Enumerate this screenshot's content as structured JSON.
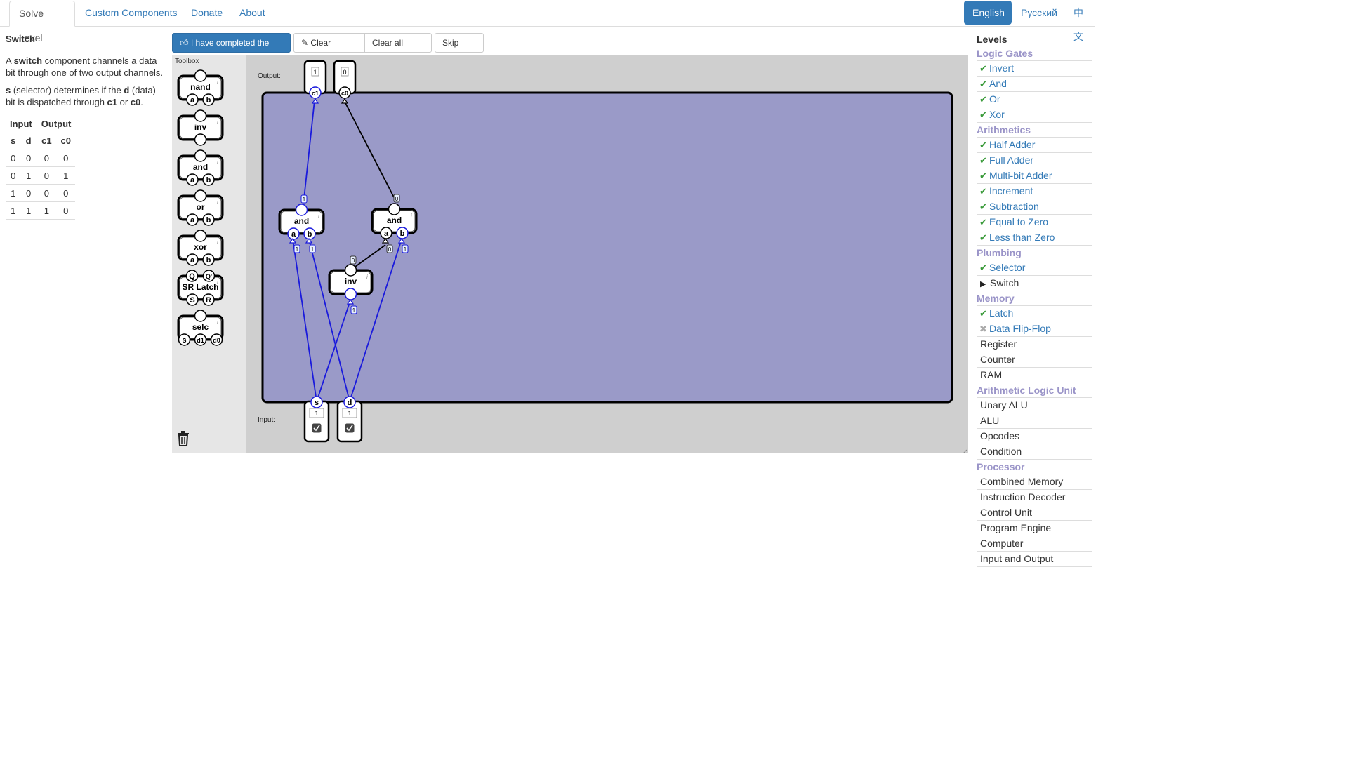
{
  "nav": {
    "tabs": [
      "Solve Level",
      "Custom Components",
      "Donate",
      "About"
    ],
    "languages": [
      "English",
      "Русский",
      "中文"
    ]
  },
  "level": {
    "title": "Switch",
    "desc1_pre": "A ",
    "desc1_bold": "switch",
    "desc1_post": " component channels a data bit through one of two output channels.",
    "desc2_b1": "s",
    "desc2_t1": " (selector) determines if the ",
    "desc2_b2": "d",
    "desc2_t2": " (data) bit is dispatched through ",
    "desc2_b3": "c1",
    "desc2_t3": " or ",
    "desc2_b4": "c0",
    "desc2_t4": ".",
    "truth_table": {
      "group_headers": [
        "Input",
        "Output"
      ],
      "columns": [
        "s",
        "d",
        "c1",
        "c0"
      ],
      "rows": [
        [
          "0",
          "0",
          "0",
          "0"
        ],
        [
          "0",
          "1",
          "0",
          "1"
        ],
        [
          "1",
          "0",
          "0",
          "0"
        ],
        [
          "1",
          "1",
          "1",
          "0"
        ]
      ]
    }
  },
  "toolbar": {
    "completed": "I have completed the level",
    "clear_canvas": "Clear canvas",
    "clear_all": "Clear all levels",
    "skip": "Skip level"
  },
  "toolbox": {
    "label": "Toolbox",
    "items": [
      {
        "name": "nand",
        "inputs": [
          "a",
          "b"
        ]
      },
      {
        "name": "inv",
        "inputs": []
      },
      {
        "name": "and",
        "inputs": [
          "a",
          "b"
        ]
      },
      {
        "name": "or",
        "inputs": [
          "a",
          "b"
        ]
      },
      {
        "name": "xor",
        "inputs": [
          "a",
          "b"
        ]
      },
      {
        "name": "SR Latch",
        "outputs": [
          "Q",
          "Q'"
        ],
        "inputs": [
          "S",
          "R"
        ]
      },
      {
        "name": "selc",
        "inputs": [
          "s",
          "d1",
          "d0"
        ]
      }
    ]
  },
  "canvas": {
    "output_label": "Output:",
    "input_label": "Input:",
    "outputs": [
      {
        "pin": "c1",
        "value": "1"
      },
      {
        "pin": "c0",
        "value": "0"
      }
    ],
    "inputs": [
      {
        "pin": "s",
        "value": "1",
        "checked": true
      },
      {
        "pin": "d",
        "value": "1",
        "checked": true
      }
    ],
    "gates": [
      {
        "id": "and1",
        "name": "and",
        "inputs": [
          "a",
          "b"
        ],
        "out_value": "1",
        "in_values": [
          "1",
          "1"
        ]
      },
      {
        "id": "and2",
        "name": "and",
        "inputs": [
          "a",
          "b"
        ],
        "out_value": "0",
        "in_values": [
          "0",
          "1"
        ]
      },
      {
        "id": "inv1",
        "name": "inv",
        "out_value": "0",
        "in_values": [
          "1"
        ]
      }
    ],
    "active_color": "#1a1adc",
    "board_color": "#9a9ac8"
  },
  "levels": {
    "title": "Levels",
    "groups": [
      {
        "name": "Logic Gates",
        "items": [
          {
            "label": "Invert",
            "status": "done"
          },
          {
            "label": "And",
            "status": "done"
          },
          {
            "label": "Or",
            "status": "done"
          },
          {
            "label": "Xor",
            "status": "done"
          }
        ]
      },
      {
        "name": "Arithmetics",
        "items": [
          {
            "label": "Half Adder",
            "status": "done"
          },
          {
            "label": "Full Adder",
            "status": "done"
          },
          {
            "label": "Multi-bit Adder",
            "status": "done"
          },
          {
            "label": "Increment",
            "status": "done"
          },
          {
            "label": "Subtraction",
            "status": "done"
          },
          {
            "label": "Equal to Zero",
            "status": "done"
          },
          {
            "label": "Less than Zero",
            "status": "done"
          }
        ]
      },
      {
        "name": "Plumbing",
        "items": [
          {
            "label": "Selector",
            "status": "done"
          },
          {
            "label": "Switch",
            "status": "current"
          }
        ]
      },
      {
        "name": "Memory",
        "items": [
          {
            "label": "Latch",
            "status": "done"
          },
          {
            "label": "Data Flip-Flop",
            "status": "failed"
          },
          {
            "label": "Register",
            "status": "none"
          },
          {
            "label": "Counter",
            "status": "none"
          },
          {
            "label": "RAM",
            "status": "none"
          }
        ]
      },
      {
        "name": "Arithmetic Logic Unit",
        "items": [
          {
            "label": "Unary ALU",
            "status": "none"
          },
          {
            "label": "ALU",
            "status": "none"
          },
          {
            "label": "Opcodes",
            "status": "none"
          },
          {
            "label": "Condition",
            "status": "none"
          }
        ]
      },
      {
        "name": "Processor",
        "items": [
          {
            "label": "Combined Memory",
            "status": "none"
          },
          {
            "label": "Instruction Decoder",
            "status": "none"
          },
          {
            "label": "Control Unit",
            "status": "none"
          },
          {
            "label": "Program Engine",
            "status": "none"
          },
          {
            "label": "Computer",
            "status": "none"
          },
          {
            "label": "Input and Output",
            "status": "none"
          }
        ]
      }
    ]
  },
  "icons": {
    "completed": "thumbs-up-icon",
    "clear": "eraser-icon",
    "trash": "trash-icon",
    "done": "checkmark-icon",
    "failed": "cross-icon",
    "current": "play-icon"
  }
}
